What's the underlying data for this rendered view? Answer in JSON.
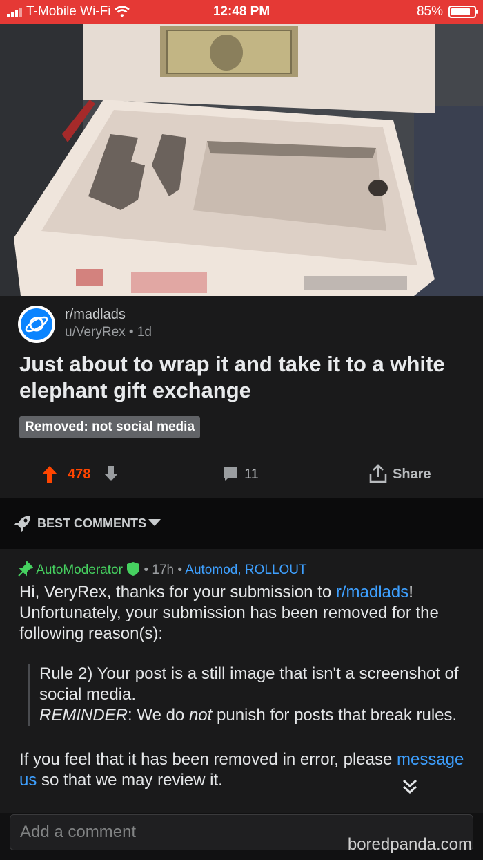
{
  "status_bar": {
    "carrier": "T-Mobile Wi-Fi",
    "time": "12:48 PM",
    "battery": "85%",
    "battery_level": 0.85,
    "bar_color": "#e53935"
  },
  "post": {
    "subreddit": "r/madlads",
    "author_line": "u/VeryRex • 1d",
    "title": "Just about to wrap it and take it to a white elephant gift exchange",
    "removed_badge": "Removed: not social media",
    "score": "478",
    "comment_count": "11",
    "share_label": "Share",
    "score_color": "#ff4500",
    "icons": [
      "planet-icon",
      "upvote-icon",
      "downvote-icon",
      "comment-icon",
      "share-icon"
    ]
  },
  "sort": {
    "label": "BEST COMMENTS",
    "icon": "rocket-icon"
  },
  "comment": {
    "author": "AutoModerator",
    "time": "• 17h •",
    "flair": "Automod, ROLLOUT",
    "greeting": "Hi, VeryRex, thanks for your submission to ",
    "sub_link": "r/madlads",
    "greeting_end": "!",
    "line2": "Unfortunately, your submission has been removed for the following reason(s):",
    "rule": "Rule 2) Your post is a still image that isn't a screenshot of social media.",
    "reminder_label": "REMINDER",
    "reminder_1": ": We do ",
    "reminder_not": "not",
    "reminder_2": " punish for posts that break rules.",
    "error_text": "If you feel that it has been removed in error, please ",
    "message_link": "message us",
    "error_text_end": " so that we may review it.",
    "mod_color": "#46d160",
    "link_color": "#3ea0ff"
  },
  "input": {
    "placeholder": "Add a comment"
  },
  "watermark": "boredpanda.com"
}
